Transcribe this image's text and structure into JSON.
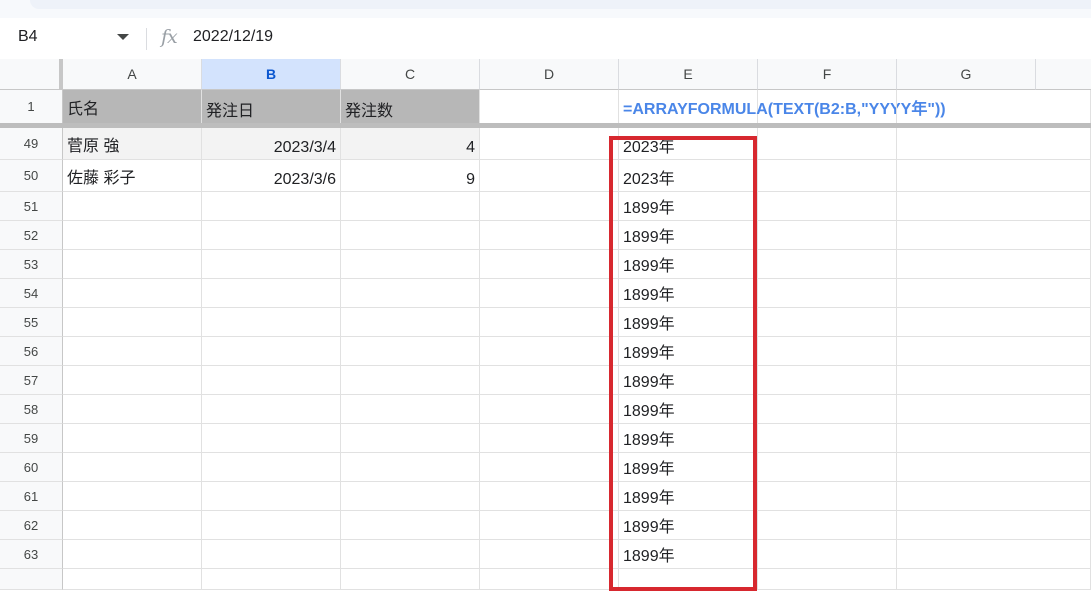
{
  "formula_bar": {
    "cell_ref": "B4",
    "fx_icon": "fx",
    "value": "2022/12/19"
  },
  "columns": [
    "A",
    "B",
    "C",
    "D",
    "E",
    "F",
    "G"
  ],
  "selected_column": "B",
  "header_row": {
    "row_number": "1",
    "A": "氏名",
    "B": "発注日",
    "C": "発注数",
    "E": "=ARRAYFORMULA(TEXT(B2:B,\"YYYY年\"))"
  },
  "rows": [
    {
      "num": "49",
      "A": "菅原 強",
      "B": "2023/3/4",
      "C": "4",
      "E": "2023年"
    },
    {
      "num": "50",
      "A": "佐藤 彩子",
      "B": "2023/3/6",
      "C": "9",
      "E": "2023年"
    },
    {
      "num": "51",
      "E": "1899年"
    },
    {
      "num": "52",
      "E": "1899年"
    },
    {
      "num": "53",
      "E": "1899年"
    },
    {
      "num": "54",
      "E": "1899年"
    },
    {
      "num": "55",
      "E": "1899年"
    },
    {
      "num": "56",
      "E": "1899年"
    },
    {
      "num": "57",
      "E": "1899年"
    },
    {
      "num": "58",
      "E": "1899年"
    },
    {
      "num": "59",
      "E": "1899年"
    },
    {
      "num": "60",
      "E": "1899年"
    },
    {
      "num": "61",
      "E": "1899年"
    },
    {
      "num": "62",
      "E": "1899年"
    },
    {
      "num": "63",
      "E": "1899年"
    }
  ],
  "colors": {
    "highlight_box": "#d7282f",
    "header_fill": "#b7b7b7",
    "formula_text": "#4a86e8",
    "selected_header": "#d3e3fd"
  }
}
